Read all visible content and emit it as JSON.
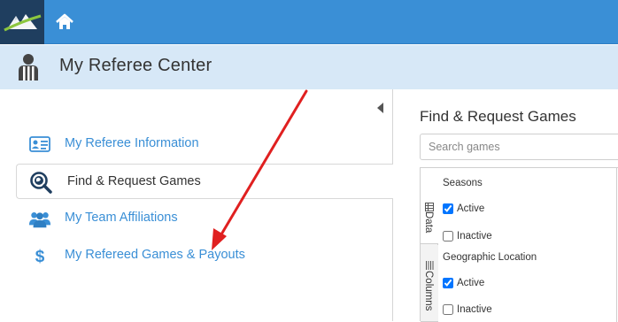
{
  "header": {
    "logo_icon": "mountain-logo-icon",
    "home_icon": "home-icon",
    "bar_color": "#3a8fd6",
    "logo_bg": "#1f3e5f"
  },
  "titlebar": {
    "icon": "referee-icon",
    "title": "My Referee Center"
  },
  "sidebar": {
    "collapse_icon": "chevron-left-icon",
    "items": [
      {
        "label": "My Referee Information",
        "icon": "id-card-icon",
        "active": false
      },
      {
        "label": "Find & Request Games",
        "icon": "search-globe-icon",
        "active": true
      },
      {
        "label": "My Team Affiliations",
        "icon": "people-icon",
        "active": false
      },
      {
        "label": "My Refereed Games & Payouts",
        "icon": "dollar-icon",
        "active": false
      }
    ]
  },
  "main": {
    "title": "Find & Request Games",
    "search": {
      "placeholder": "Search games",
      "value": ""
    },
    "side_tabs": [
      {
        "label": "Data",
        "icon": "table-icon",
        "active": true
      },
      {
        "label": "Columns",
        "icon": "columns-icon",
        "active": false
      }
    ],
    "filters": [
      {
        "title": "Seasons",
        "options": [
          {
            "label": "Active",
            "checked": true
          },
          {
            "label": "Inactive",
            "checked": false
          }
        ]
      },
      {
        "title": "Geographic Location",
        "options": [
          {
            "label": "Active",
            "checked": true
          },
          {
            "label": "Inactive",
            "checked": false
          }
        ]
      }
    ]
  },
  "annotation": {
    "arrow_color": "#e02020"
  }
}
